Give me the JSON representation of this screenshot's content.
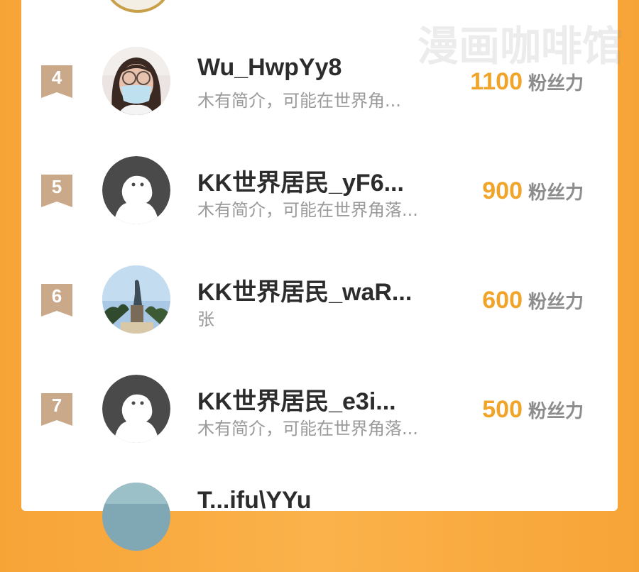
{
  "watermark": "漫画咖啡馆",
  "score_unit": "粉丝力",
  "rows": [
    {
      "rank": "4",
      "name": "Wu_HwpYy8",
      "bio": "木有简介，可能在世界角...",
      "score": "1100",
      "avatar": "photo-woman-mask"
    },
    {
      "rank": "5",
      "name": "KK世界居民_yF6...",
      "bio": "木有简介，可能在世界角落...",
      "score": "900",
      "avatar": "default-ghost"
    },
    {
      "rank": "6",
      "name": "KK世界居民_waR...",
      "bio": "张",
      "score": "600",
      "avatar": "photo-statue"
    },
    {
      "rank": "7",
      "name": "KK世界居民_e3i...",
      "bio": "木有简介，可能在世界角落...",
      "score": "500",
      "avatar": "default-ghost"
    },
    {
      "rank": "",
      "name": "T...ifu\\YYu",
      "bio": "",
      "score": "",
      "avatar": "photo-sky"
    }
  ],
  "colors": {
    "accent": "#f0a52a",
    "badge": "#c9a989",
    "background": "#f7a437"
  }
}
